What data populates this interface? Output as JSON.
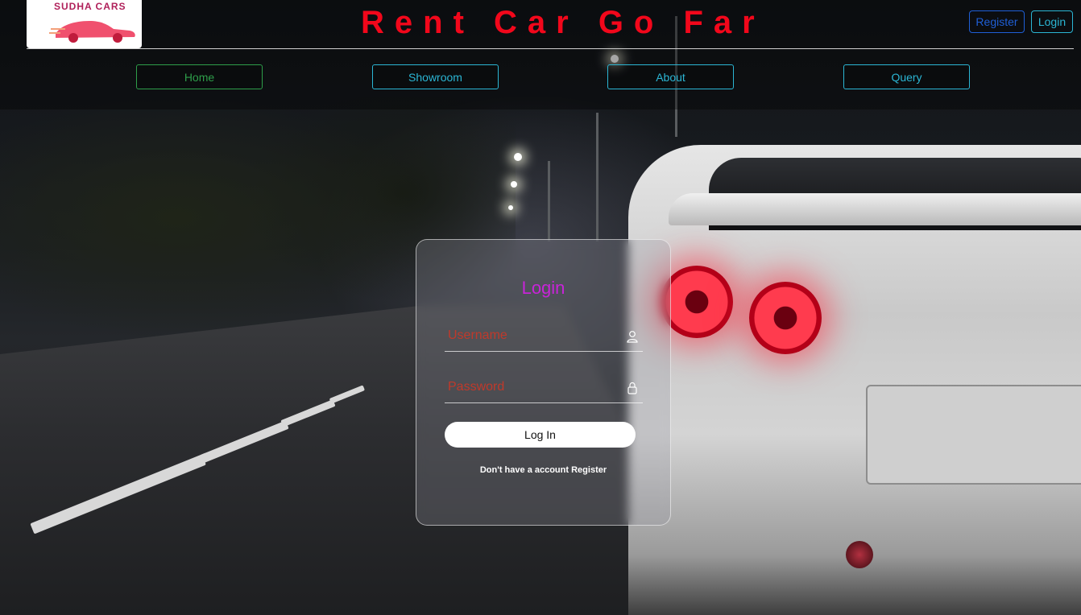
{
  "header": {
    "logo_text": "SUDHA CARS",
    "title": "Rent Car Go Far",
    "register_label": "Register",
    "login_label": "Login"
  },
  "nav": {
    "items": [
      {
        "label": "Home",
        "color": "#2e9e4a"
      },
      {
        "label": "Showroom",
        "color": "#2bb6d4"
      },
      {
        "label": "About",
        "color": "#2bb6d4"
      },
      {
        "label": "Query",
        "color": "#2bb6d4"
      }
    ]
  },
  "login_form": {
    "title": "Login",
    "username_placeholder": "Username",
    "password_placeholder": "Password",
    "submit_label": "Log In",
    "register_prompt": "Don't have a account",
    "register_link": "Register"
  },
  "colors": {
    "title_red": "#f2071b",
    "login_title": "#c824d8",
    "register_btn": "#1f5fd6",
    "login_btn": "#2bb6d4"
  }
}
